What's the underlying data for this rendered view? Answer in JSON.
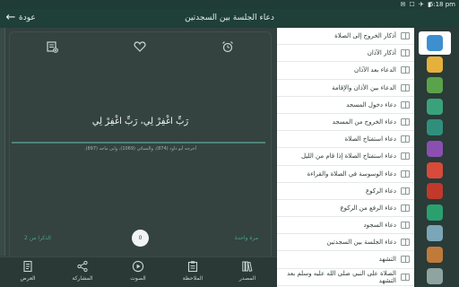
{
  "status_bar": {
    "time": "6:18 pm",
    "icons": "✉ ☐ ✈ ▮"
  },
  "app_bar": {
    "back_label": "عودة",
    "title": "دعاء الجلسة بين السجدتين"
  },
  "detail": {
    "duaa_text": "رَبِّ اغْفِرْ لِي، رَبِّ اغْفِرْ لِي",
    "source_text": "أخرجه أبو داود (874)، والنسائي (1069)، وابن ماجه (897).",
    "count_label_left": "الذكرا من 2",
    "count_label_right": "مرة واحدة",
    "counter_value": "0"
  },
  "toolbar_icons": {
    "top_left": "add-note-icon",
    "top_mid": "favorite-heart-icon",
    "top_right": "alarm-icon"
  },
  "bottom_bar": [
    {
      "key": "display",
      "label": "العرض",
      "icon": "document-icon"
    },
    {
      "key": "share",
      "label": "المشاركة",
      "icon": "share-icon"
    },
    {
      "key": "sound",
      "label": "الصوت",
      "icon": "play-icon"
    },
    {
      "key": "note",
      "label": "الملاحظة",
      "icon": "clipboard-icon"
    },
    {
      "key": "source",
      "label": "المصدر",
      "icon": "books-icon"
    }
  ],
  "list_items": [
    "أذكار الخروج إلى الصلاة",
    "أذكار الآذان",
    "الدعاء بعد الآذان",
    "الدعاء بين الأذان والإقامة",
    "دعاء دخول المسجد",
    "دعاء الخروج من المسجد",
    "دعاء استفتاح الصلاة",
    "دعاء استفتاح الصلاة إذا قام من الليل",
    "دعاء الوسوسة في الصلاة والقراءة",
    "دعاء الركوع",
    "دعاء الرفع من الركوع",
    "دعاء السجود",
    "دعاء الجلسة بين السجدتين",
    "التشهد",
    "الصلاة على النبي صلى الله عليه وسلم بعد التشهد"
  ],
  "categories": [
    {
      "icon": "mosque-icon",
      "color": "#3d8fd0",
      "active": true
    },
    {
      "icon": "day-night-icon",
      "color": "#e6b13b"
    },
    {
      "icon": "quran-icon",
      "color": "#5aa34a"
    },
    {
      "icon": "tasbih-icon",
      "color": "#3aa27a"
    },
    {
      "icon": "location-pin-icon",
      "color": "#2f8f7c"
    },
    {
      "icon": "home-icon",
      "color": "#8a4fb0"
    },
    {
      "icon": "person-icon",
      "color": "#d84a3a"
    },
    {
      "icon": "family-icon",
      "color": "#c0392b"
    },
    {
      "icon": "prayer-icon",
      "color": "#2aa06f"
    },
    {
      "icon": "globe-icon",
      "color": "#7aa6b7"
    },
    {
      "icon": "praying-hands-icon",
      "color": "#c07a3a"
    },
    {
      "icon": "user-icon",
      "color": "#8fa3a0"
    }
  ]
}
